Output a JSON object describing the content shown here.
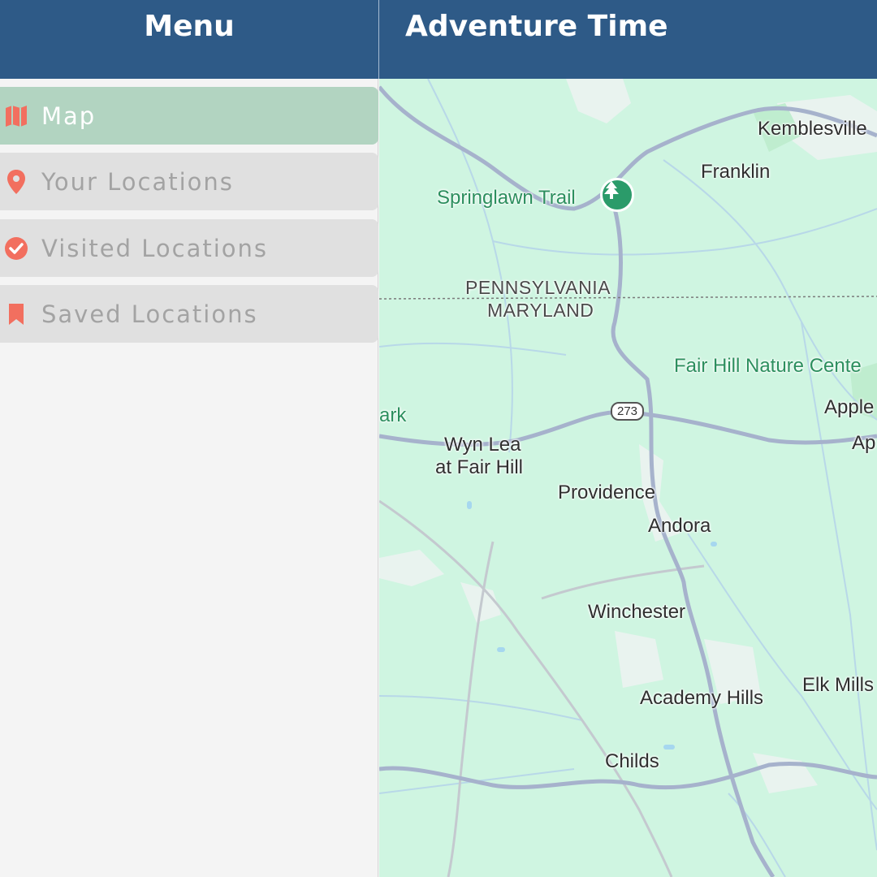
{
  "header": {
    "menu_title": "Menu",
    "app_title": "Adventure Time"
  },
  "sidebar": {
    "items": [
      {
        "label": "Map",
        "icon": "map-icon",
        "active": true
      },
      {
        "label": "Your Locations",
        "icon": "location-pin-icon",
        "active": false
      },
      {
        "label": "Visited Locations",
        "icon": "check-circle-icon",
        "active": false
      },
      {
        "label": "Saved Locations",
        "icon": "bookmark-icon",
        "active": false
      }
    ]
  },
  "map": {
    "places": {
      "kemblesville": "Kemblesville",
      "franklin": "Franklin",
      "springlawn_trail": "Springlawn Trail",
      "pennsylvania": "PENNSYLVANIA",
      "maryland": "MARYLAND",
      "fair_hill_nature": "Fair Hill Nature Cente",
      "apple1": "Apple",
      "apple2": "Ap",
      "park_fragment": "ark",
      "wyn_lea_1": "Wyn Lea",
      "wyn_lea_2": "at Fair Hill",
      "providence": "Providence",
      "andora": "Andora",
      "winchester": "Winchester",
      "academy_hills": "Academy Hills",
      "elk_mills": "Elk Mills",
      "childs": "Childs"
    },
    "route_shield": "273"
  },
  "colors": {
    "header_bg": "#2e5a87",
    "active_item_bg": "#b2d4c1",
    "inactive_item_bg": "#e0e0e0",
    "icon_accent": "#f26f5f",
    "map_bg": "#cff5e1",
    "park_green": "#2b9b6a"
  }
}
